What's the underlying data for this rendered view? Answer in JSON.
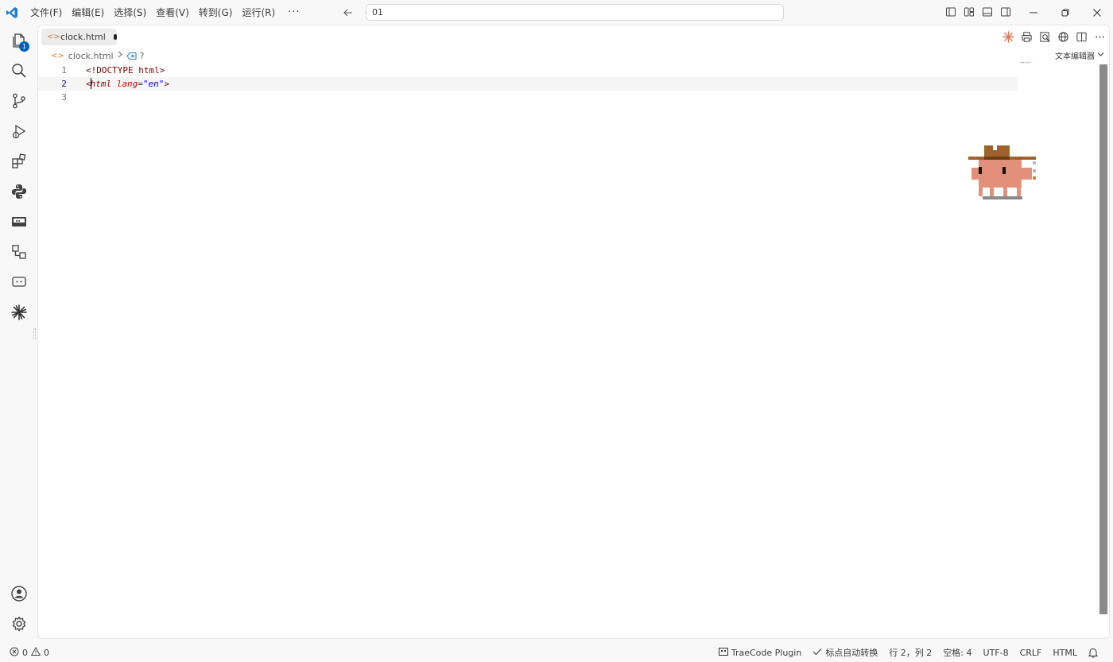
{
  "titlebar": {
    "menu": [
      "文件(F)",
      "编辑(E)",
      "选择(S)",
      "查看(V)",
      "转到(G)",
      "运行(R)"
    ],
    "more": "···",
    "command_center": "01"
  },
  "activitybar": {
    "explorer_badge": "1"
  },
  "tab": {
    "filename": "clock.html",
    "icon": "<>"
  },
  "breadcrumb": {
    "file": "clock.html",
    "symbol": "?"
  },
  "editor_mode": "文本编辑器",
  "code": {
    "lines": [
      {
        "number": "1",
        "doctype_open": "<!",
        "doctype": "DOCTYPE",
        "space": " ",
        "doctype_value": "html",
        "close": ">"
      },
      {
        "number": "2",
        "lt": "<",
        "tag": "html",
        "space": " ",
        "attr": "lang",
        "eq": "=",
        "value": "\"en\"",
        "gt": ">"
      },
      {
        "number": "3"
      }
    ],
    "current_line": 2
  },
  "statusbar": {
    "errors": "0",
    "warnings": "0",
    "plugin": "TraeCode Plugin",
    "punct": "标点自动转换",
    "position": "行 2，列 2",
    "indent": "空格: 4",
    "encoding": "UTF-8",
    "eol": "CRLF",
    "language": "HTML"
  },
  "colors": {
    "accent": "#005fb8",
    "file_icon": "#e37933",
    "trae_icon": "#d97757"
  }
}
